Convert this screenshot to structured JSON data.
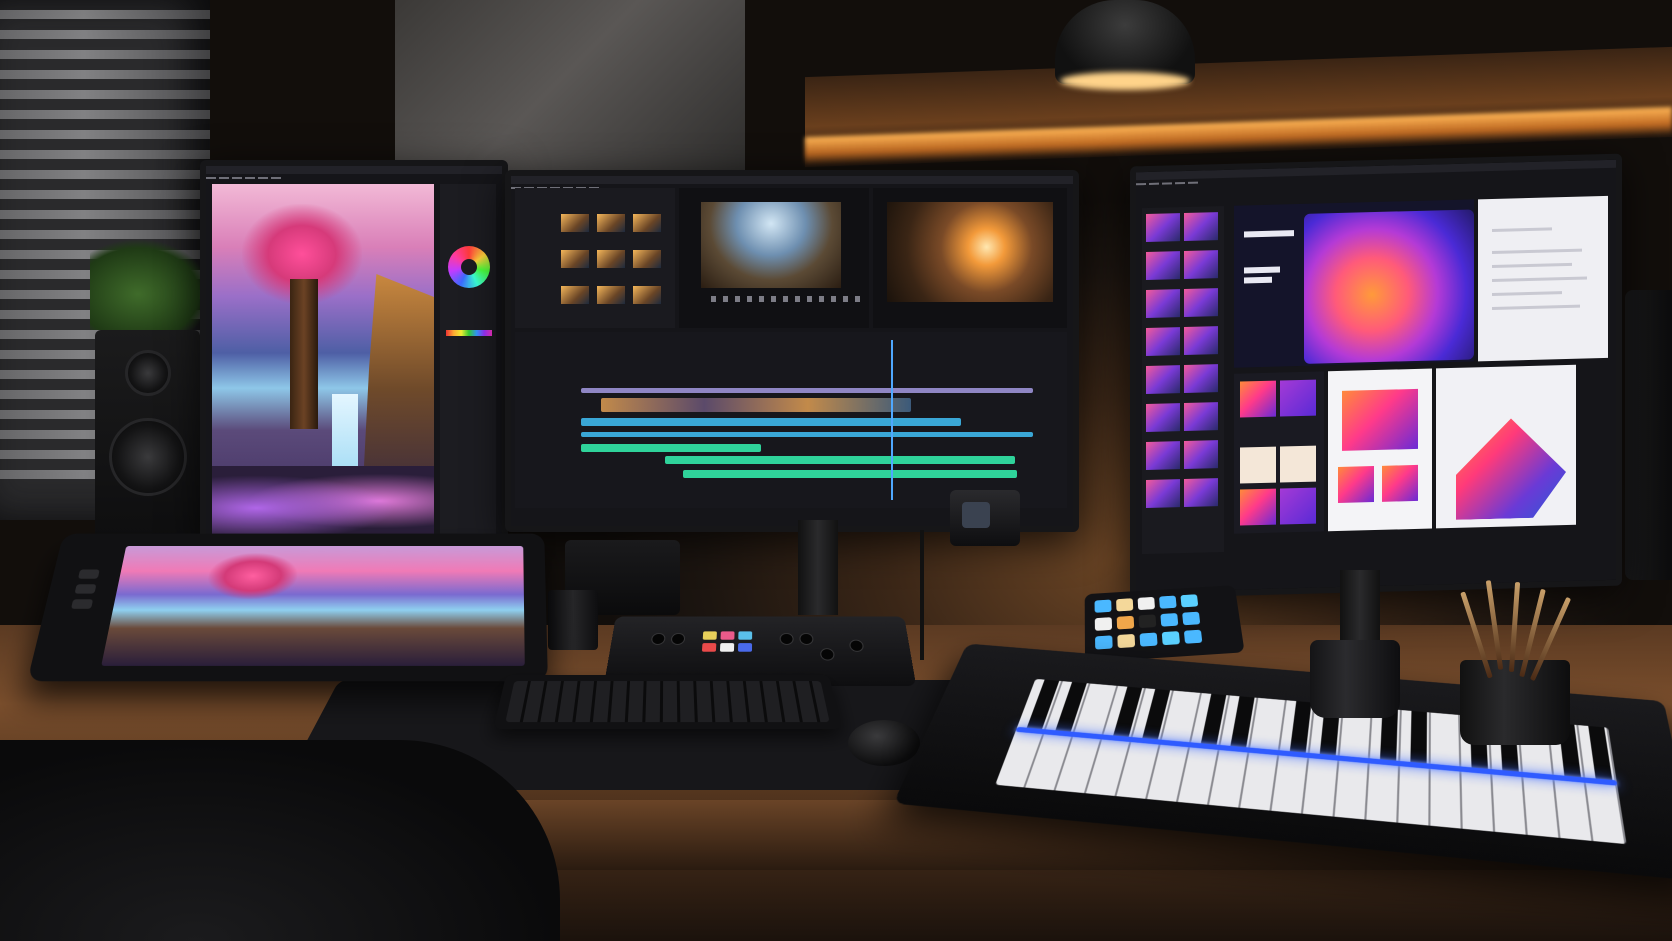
{
  "scene": {
    "description_tag": "creative-studio-desk",
    "colors": {
      "wall": "#3a2617",
      "shelf_light": "#ffb657",
      "desk_wood": "#7a4e2c",
      "midi_led": "#2f5bff",
      "timeline_video": "#8f86c4",
      "timeline_audio_1": "#3aa7d6",
      "timeline_audio_2": "#2fd39a",
      "hero_gradient_a": "#ff9a3a",
      "hero_gradient_b": "#4a2ad6"
    }
  },
  "icons": {
    "color_wheel": "color-wheel-icon",
    "playhead": "playhead-marker",
    "transport": "transport-controls"
  }
}
